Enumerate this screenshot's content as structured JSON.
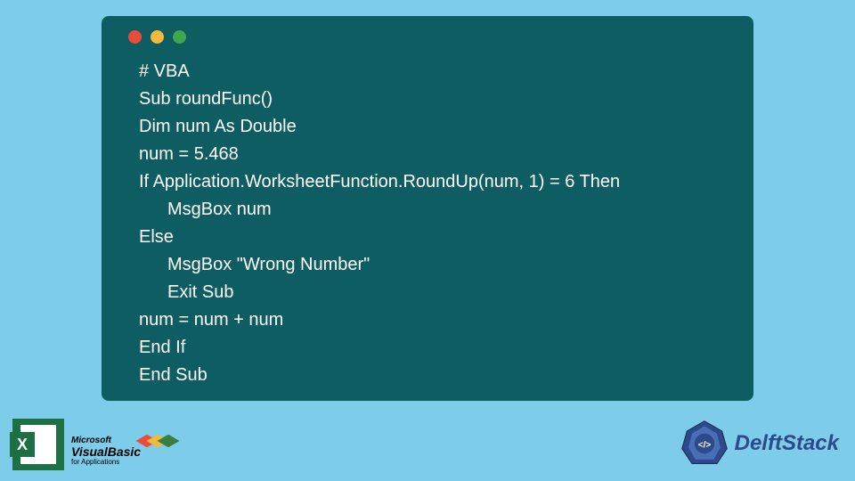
{
  "code": {
    "line1": "# VBA",
    "line2": "Sub roundFunc()",
    "line3": "Dim num As Double",
    "line4": "num = 5.468",
    "line5": "If Application.WorksheetFunction.RoundUp(num, 1) = 6 Then",
    "line6": "MsgBox num",
    "line7": "Else",
    "line8": "MsgBox \"Wrong Number\"",
    "line9": "Exit Sub",
    "line10": "num = num + num",
    "line11": "End If",
    "line12": "End Sub"
  },
  "excel": {
    "letter": "X"
  },
  "vb": {
    "microsoft": "Microsoft",
    "visualbasic": "VisualBasic",
    "forapps": "for Applications"
  },
  "delftstack": {
    "text": "DelftStack",
    "tag": "</>"
  }
}
